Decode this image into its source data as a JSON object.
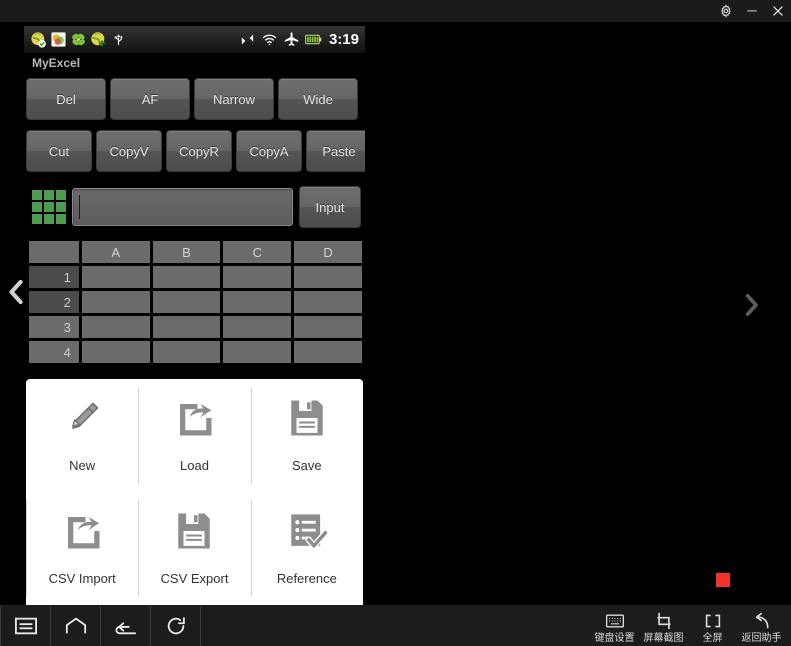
{
  "window": {
    "controls": [
      {
        "name": "settings-icon",
        "label": "Settings"
      },
      {
        "name": "minimize-icon",
        "label": "Minimize"
      },
      {
        "name": "close-icon",
        "label": "Close"
      }
    ]
  },
  "status_bar": {
    "notification_icons": [
      "browser-check-icon",
      "gallery-icon",
      "clover-icon",
      "browser-add-icon",
      "usb-icon"
    ],
    "system_icons": [
      "signal-icon",
      "wifi-icon",
      "airplane-mode-icon",
      "battery-icon"
    ],
    "clock": "3:19"
  },
  "app": {
    "title": "MyExcel",
    "toolbar_row1": [
      {
        "label": "Del",
        "name": "del-button"
      },
      {
        "label": "AF",
        "name": "af-button"
      },
      {
        "label": "Narrow",
        "name": "narrow-button"
      },
      {
        "label": "Wide",
        "name": "wide-button"
      }
    ],
    "toolbar_row2": [
      {
        "label": "Cut",
        "name": "cut-button"
      },
      {
        "label": "CopyV",
        "name": "copyv-button"
      },
      {
        "label": "CopyR",
        "name": "copyr-button"
      },
      {
        "label": "CopyA",
        "name": "copya-button"
      },
      {
        "label": "Paste",
        "name": "paste-button"
      }
    ],
    "input_row": {
      "grid_icon": "grid-icon",
      "value": "",
      "placeholder": "",
      "button_label": "Input"
    },
    "sheet": {
      "corner_label": "",
      "columns": [
        "A",
        "B",
        "C",
        "D"
      ],
      "rows": [
        {
          "header": "1",
          "selected": true,
          "cells": [
            "",
            "",
            "",
            ""
          ]
        },
        {
          "header": "2",
          "selected": true,
          "cells": [
            "",
            "",
            "",
            ""
          ]
        },
        {
          "header": "3",
          "selected": false,
          "cells": [
            "",
            "",
            "",
            ""
          ]
        },
        {
          "header": "4",
          "selected": false,
          "cells": [
            "",
            "",
            "",
            ""
          ]
        }
      ]
    },
    "menu_sheet": [
      {
        "label": "New",
        "name": "menu-new",
        "icon": "pencil-icon"
      },
      {
        "label": "Load",
        "name": "menu-load",
        "icon": "load-arrow-icon"
      },
      {
        "label": "Save",
        "name": "menu-save",
        "icon": "floppy-icon"
      },
      {
        "label": "CSV Import",
        "name": "menu-csv-import",
        "icon": "load-arrow-icon"
      },
      {
        "label": "CSV Export",
        "name": "menu-csv-export",
        "icon": "floppy-icon"
      },
      {
        "label": "Reference",
        "name": "menu-reference",
        "icon": "checklist-icon"
      }
    ],
    "page_nav": {
      "prev_icon": "chevron-left-icon",
      "next_icon": "chevron-right-icon"
    },
    "recording_indicator": {
      "name": "recording-indicator",
      "color": "#f3302a"
    }
  },
  "system_nav": {
    "buttons": [
      {
        "name": "nav-menu-button",
        "icon": "menu-icon"
      },
      {
        "name": "nav-home-button",
        "icon": "home-icon"
      },
      {
        "name": "nav-back-button",
        "icon": "back-icon"
      },
      {
        "name": "nav-refresh-button",
        "icon": "refresh-icon"
      }
    ],
    "tools": [
      {
        "label": "键盘设置",
        "name": "keyboard-settings-button",
        "icon": "keyboard-icon"
      },
      {
        "label": "屏幕截图",
        "name": "screenshot-button",
        "icon": "crop-icon"
      },
      {
        "label": "全屏",
        "name": "fullscreen-button",
        "icon": "fullscreen-icon"
      },
      {
        "label": "返回助手",
        "name": "return-assistant-button",
        "icon": "back-arrow-icon"
      }
    ]
  },
  "colors": {
    "accent_green": "#4f9b4f",
    "recording_red": "#f3302a",
    "chrome_bg": "#1b1b1b",
    "nav_bg": "#1c1c1c"
  }
}
